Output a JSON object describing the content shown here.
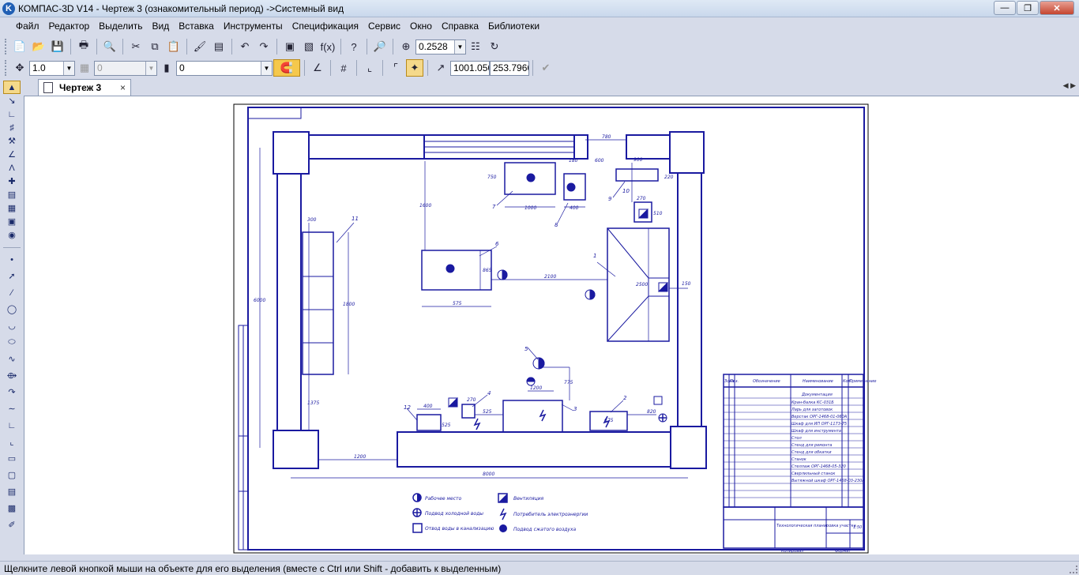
{
  "window": {
    "title": "КОМПАС-3D V14 - Чертеж 3 (ознакомительный период) ->Системный вид",
    "app_icon_glyph": "K",
    "minimize": "—",
    "maximize": "❐",
    "close": "✕"
  },
  "menu": [
    {
      "label": "Файл"
    },
    {
      "label": "Редактор"
    },
    {
      "label": "Выделить"
    },
    {
      "label": "Вид"
    },
    {
      "label": "Вставка"
    },
    {
      "label": "Инструменты"
    },
    {
      "label": "Спецификация"
    },
    {
      "label": "Сервис"
    },
    {
      "label": "Окно"
    },
    {
      "label": "Справка"
    },
    {
      "label": "Библиотеки"
    }
  ],
  "toolbar1": {
    "zoom_value": "0.2528"
  },
  "toolbar2": {
    "scale_value": "1.0",
    "style_value": "0",
    "layer_value": "0",
    "coord_x": "1001.056",
    "coord_y": "253.7966"
  },
  "tab": {
    "label": "Чертеж 3",
    "close": "×"
  },
  "status": {
    "hint": "Щелкните левой кнопкой мыши на объекте для его выделения (вместе с Ctrl или Shift - добавить к выделенным)"
  },
  "drawing": {
    "dimensions": {
      "d780": "780",
      "d900": "900",
      "d600": "600",
      "d180": "180",
      "d750": "750",
      "d1000": "1000",
      "d400": "400",
      "d220": "220",
      "d270": "270",
      "d510": "510",
      "d1600": "1600",
      "d6000": "6000",
      "d300": "300",
      "d1800": "1800",
      "d865": "865",
      "d575": "575",
      "d2100": "2100",
      "d2500": "2500",
      "d150": "150",
      "d1200": "1200",
      "d775": "775",
      "d1375": "1375",
      "d525": "525",
      "d675": "675",
      "d525b": "525",
      "d820": "820",
      "d1200b": "1200",
      "d8000": "8000"
    },
    "callouts": [
      "1",
      "2",
      "3",
      "4",
      "5",
      "6",
      "7",
      "8",
      "9",
      "10",
      "11",
      "12"
    ],
    "legend": {
      "workplace": "Рабочее место",
      "water_supply": "Подвод холодной воды",
      "drain": "Отвод воды в канализацию",
      "ventilation": "Вентиляция",
      "power": "Потребитель электроэнергии",
      "air": "Подвод сжатого воздуха"
    },
    "spec_header": {
      "col_zone": "Зона",
      "col_pos": "Поз.",
      "col_designation": "Обозначение",
      "col_name": "Наименование",
      "col_qty": "Кол.",
      "col_note": "Приме-чание",
      "section": "Документация"
    },
    "spec_rows": [
      "Кран-балка КС-031Б",
      "Ларь для заготовок",
      "Верстак ОРГ-1468-01-060А",
      "Шкаф для ИП ОРГ-1173-75",
      "Шкаф для инструмента",
      "Стол",
      "Стенд для ремонта",
      "Стенд для обкатки",
      "Станок",
      "Стеллаж ОРГ-1468-05-320",
      "Сверлильный станок",
      "Вытяжной шкаф ОРГ-1468-03-230А"
    ],
    "title_block": {
      "title": "Технологическая планировка участка",
      "sheet": "1:50",
      "format": "Формат",
      "copied": "Копировал"
    }
  }
}
